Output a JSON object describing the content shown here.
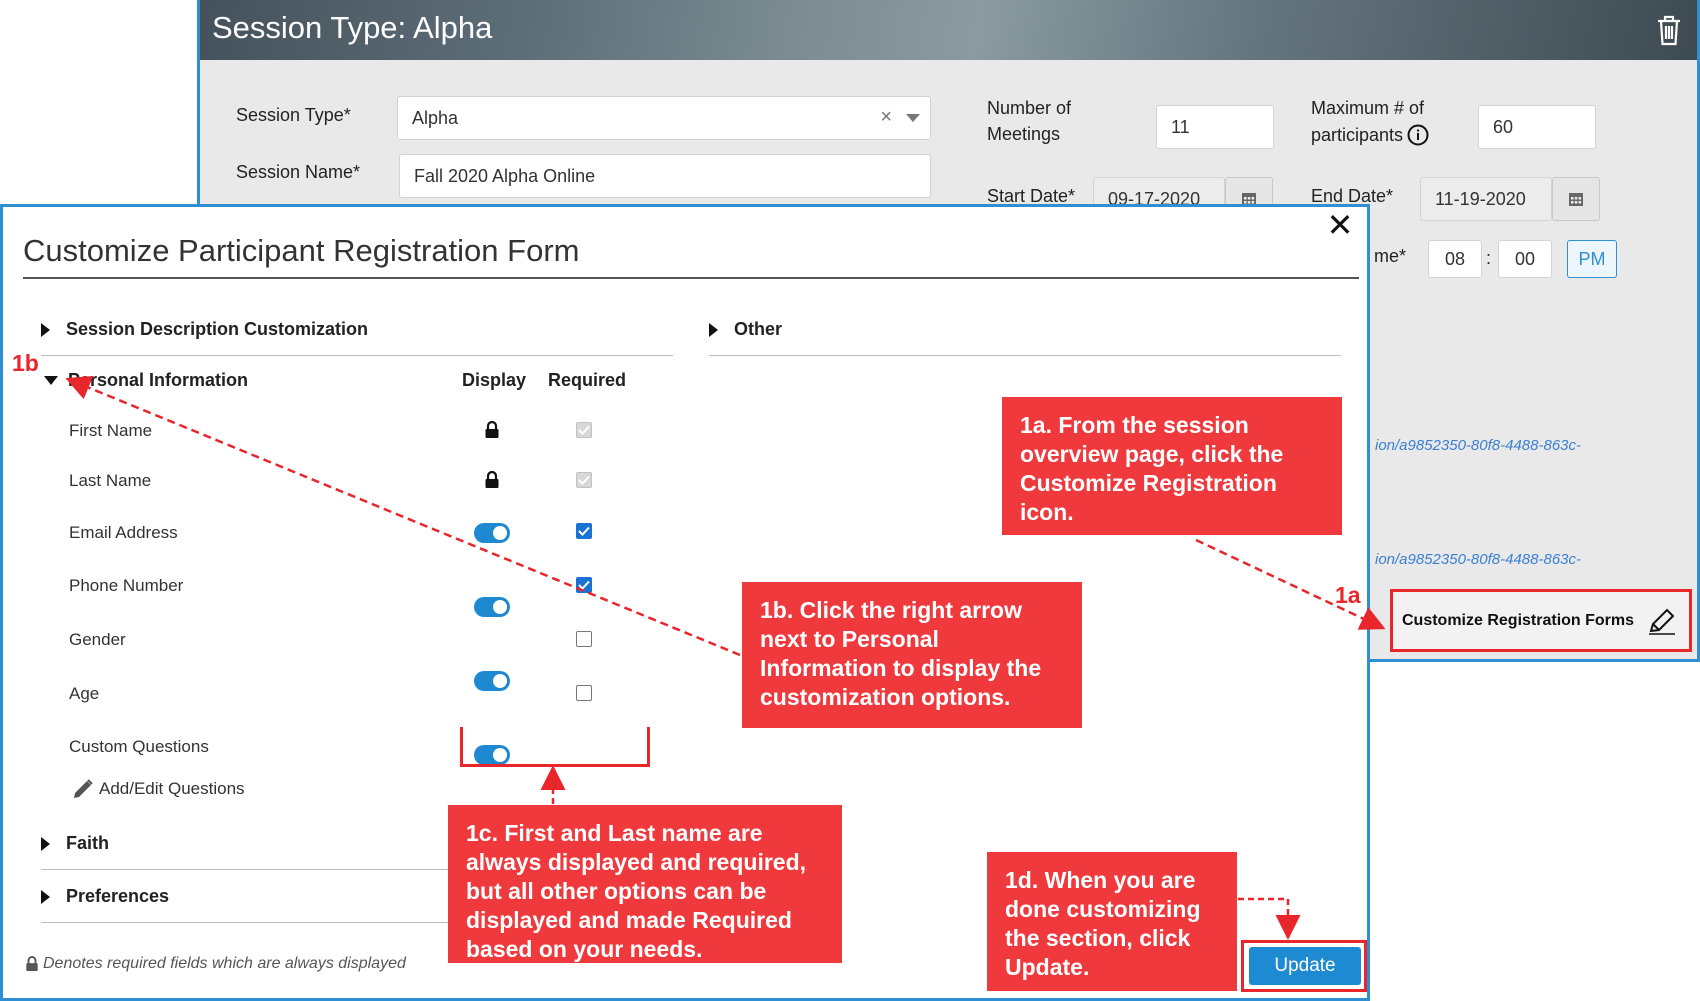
{
  "session": {
    "title": "Session Type: Alpha",
    "session_type_label": "Session Type*",
    "session_type_value": "Alpha",
    "session_name_label": "Session Name*",
    "session_name_value": "Fall 2020 Alpha Online",
    "meetings_label_1": "Number of",
    "meetings_label_2": "Meetings",
    "meetings_value": "11",
    "max_label_1": "Maximum # of",
    "max_label_2": "participants",
    "max_value": "60",
    "start_label": "Start Date*",
    "start_value": "09-17-2020",
    "end_label": "End Date*",
    "end_value": "11-19-2020",
    "time_label_partial": "me*",
    "time_hour": "08",
    "time_sep": ":",
    "time_minute": "00",
    "ampm": "PM",
    "link_1": "ion/a9852350-80f8-4488-863c-",
    "link_2": "ion/a9852350-80f8-4488-863c-",
    "customize_label": "Customize Registration Forms"
  },
  "modal": {
    "title": "Customize Participant Registration Form",
    "close_glyph": "✕",
    "sections": {
      "session_description": "Session Description Customization",
      "other": "Other",
      "personal_information": "Personal Information",
      "faith": "Faith",
      "preferences": "Preferences"
    },
    "columns": {
      "display": "Display",
      "required": "Required"
    },
    "fields": [
      {
        "label": "First Name",
        "display": "locked",
        "required": "disabled-checked"
      },
      {
        "label": "Last Name",
        "display": "locked",
        "required": "disabled-checked"
      },
      {
        "label": "Email Address",
        "display": "on",
        "required": "checked"
      },
      {
        "label": "Phone Number",
        "display": "on",
        "required": "checked"
      },
      {
        "label": "Gender",
        "display": "on",
        "required": "unchecked"
      },
      {
        "label": "Age",
        "display": "on",
        "required": "unchecked"
      },
      {
        "label": "Custom Questions",
        "display": "on",
        "required": "none"
      }
    ],
    "add_edit": "Add/Edit Questions",
    "footer_note": "Denotes required fields which are always displayed",
    "update_label": "Update"
  },
  "annotations": {
    "tag_1a": "1a",
    "tag_1b": "1b",
    "callout_1a": "1a. From the session overview page, click the Customize Registration icon.",
    "callout_1b": "1b. Click the right arrow next to Personal Information to display the customization options.",
    "callout_1c": "1c. First and Last name are always displayed and required, but all other options can be displayed and made Required based on your needs.",
    "callout_1d": "1d. When you are done customizing the section, click Update.",
    "accent_color": "#f0393d",
    "frame_color": "#2f8fd0"
  }
}
